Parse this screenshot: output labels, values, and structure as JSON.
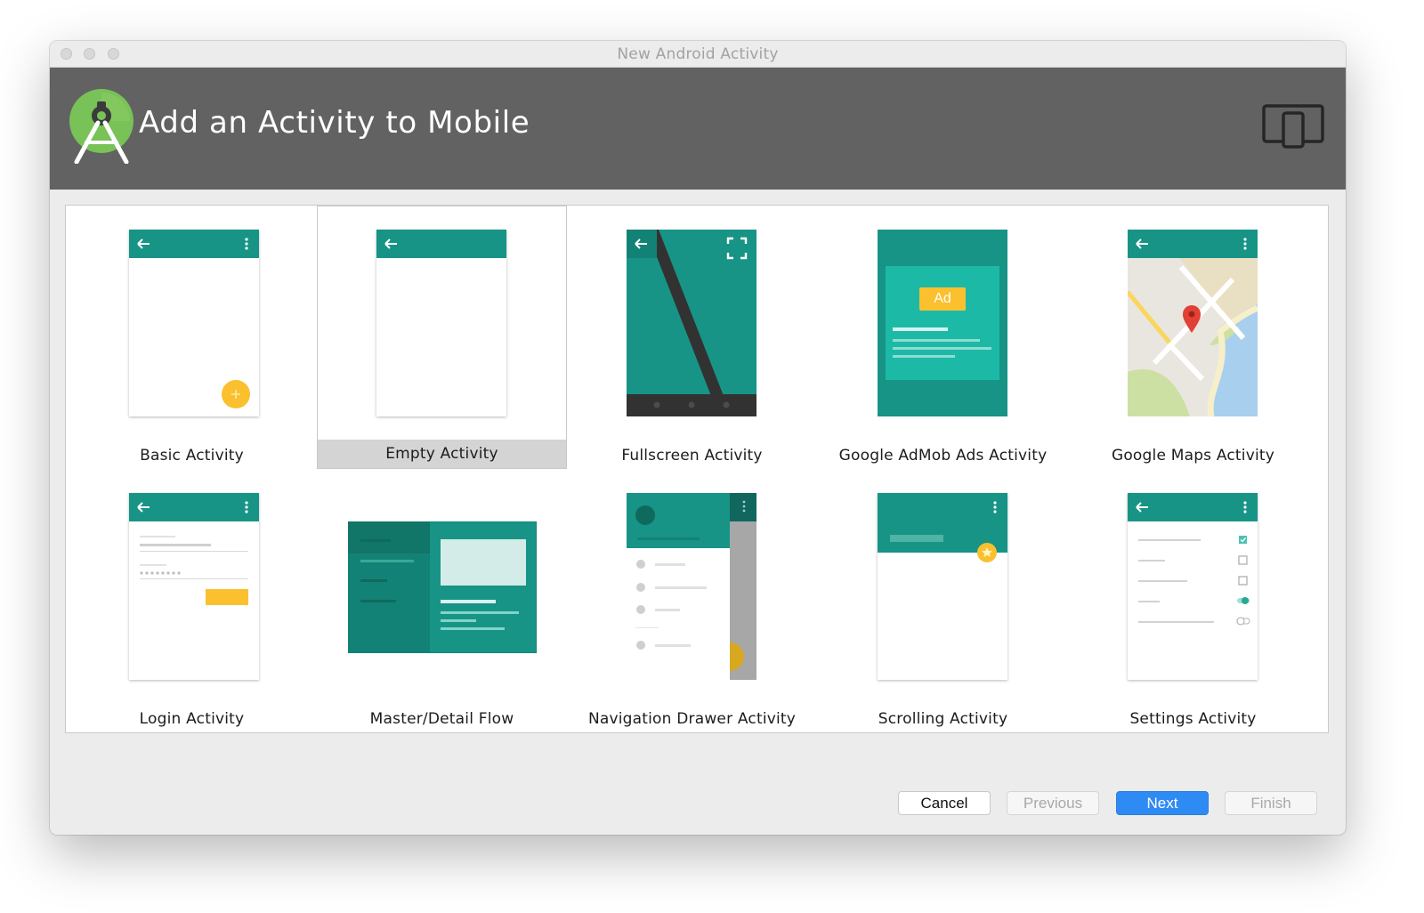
{
  "window": {
    "title": "New Android Activity"
  },
  "header": {
    "title": "Add an Activity to Mobile"
  },
  "colors": {
    "header_bg": "#626262",
    "teal": "#179486",
    "teal_light": "#1db9a5",
    "accent_yellow": "#fbc02d",
    "selected_bg": "#d4d4d4",
    "primary_button": "#2f8bf4"
  },
  "gallery": {
    "selected": "Empty Activity",
    "templates": [
      {
        "label": "Basic Activity",
        "icon": "basic-activity-thumbnail"
      },
      {
        "label": "Empty Activity",
        "icon": "empty-activity-thumbnail"
      },
      {
        "label": "Fullscreen Activity",
        "icon": "fullscreen-activity-thumbnail"
      },
      {
        "label": "Google AdMob Ads Activity",
        "icon": "admob-activity-thumbnail",
        "badge": "Ad"
      },
      {
        "label": "Google Maps Activity",
        "icon": "maps-activity-thumbnail"
      },
      {
        "label": "Login Activity",
        "icon": "login-activity-thumbnail"
      },
      {
        "label": "Master/Detail Flow",
        "icon": "master-detail-thumbnail"
      },
      {
        "label": "Navigation Drawer Activity",
        "icon": "navigation-drawer-thumbnail"
      },
      {
        "label": "Scrolling Activity",
        "icon": "scrolling-activity-thumbnail"
      },
      {
        "label": "Settings Activity",
        "icon": "settings-activity-thumbnail"
      }
    ]
  },
  "buttons": {
    "cancel": "Cancel",
    "previous": "Previous",
    "next": "Next",
    "finish": "Finish"
  }
}
